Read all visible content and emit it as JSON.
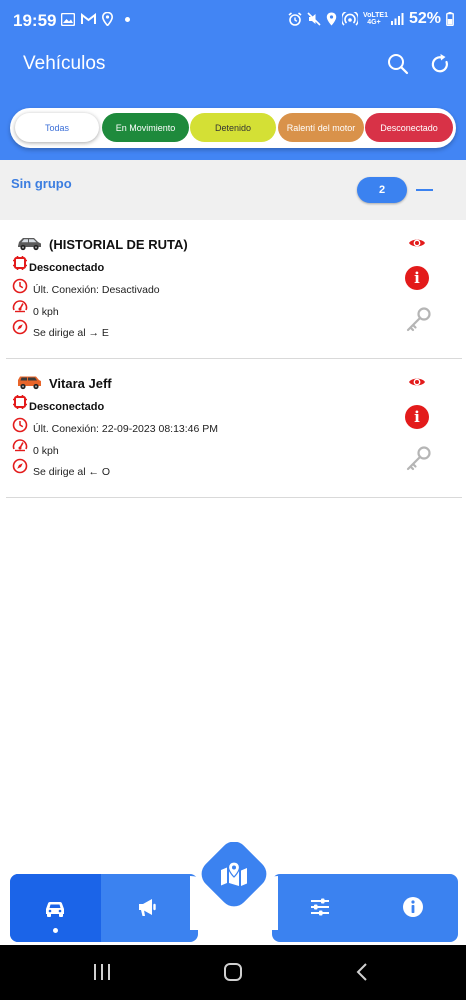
{
  "status_bar": {
    "time": "19:59",
    "network": "VoLTE1 4G+",
    "battery": "52%"
  },
  "header": {
    "title": "Vehículos",
    "icons": [
      "search-icon",
      "refresh-icon"
    ]
  },
  "filters": [
    {
      "label": "Todas",
      "color": "#ffffff"
    },
    {
      "label": "En Movimiento",
      "color": "#1e8a3c"
    },
    {
      "label": "Detenido",
      "color": "#d4e035"
    },
    {
      "label": "Ralentí del motor",
      "color": "#d9924a"
    },
    {
      "label": "Desconectado",
      "color": "#d83247"
    }
  ],
  "group": {
    "name": "Sin grupo",
    "count": "2"
  },
  "vehicles": [
    {
      "name": "(HISTORIAL DE RUTA)",
      "car_color": "#555555",
      "status": "Desconectado",
      "last_connection": "Últ. Conexión: Desactivado",
      "speed": "0 kph",
      "heading": "Se dirige al → E"
    },
    {
      "name": "Vitara Jeff",
      "car_color": "#e8652a",
      "status": "Desconectado",
      "last_connection": "Últ. Conexión: 22-09-2023 08:13:46 PM",
      "speed": "0 kph",
      "heading": "Se dirige al ← O"
    }
  ],
  "bottom_nav": {
    "items": [
      "car-icon",
      "megaphone-icon",
      "map-icon",
      "sliders-icon",
      "info-icon"
    ],
    "active": "car-icon"
  },
  "colors": {
    "primary": "#4285f4",
    "accent": "#3b82f0",
    "danger": "#e31b1b"
  }
}
